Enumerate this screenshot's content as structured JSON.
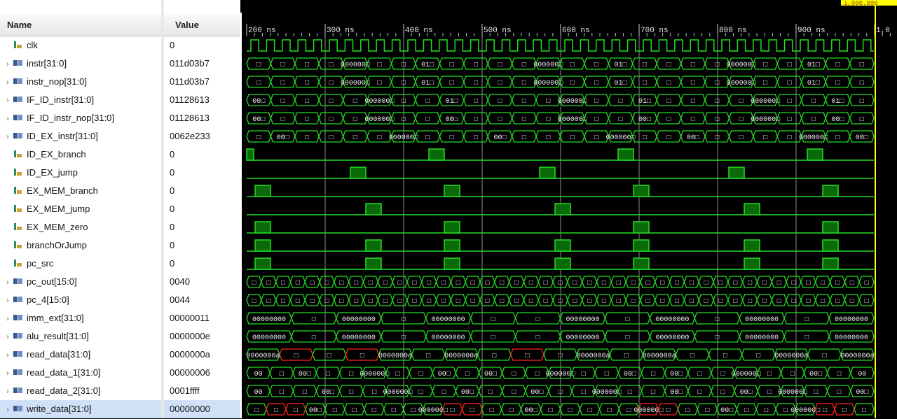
{
  "columns": {
    "name": "Name",
    "value": "Value"
  },
  "cursor": {
    "label": "1,000.000"
  },
  "timeline": {
    "ticks": [
      "200 ns",
      "300 ns",
      "400 ns",
      "500 ns",
      "600 ns",
      "700 ns",
      "800 ns",
      "900 ns",
      "1,0"
    ]
  },
  "signals": [
    {
      "name": "clk",
      "value": "0",
      "kind": "bit",
      "expandable": false
    },
    {
      "name": "instr[31:0]",
      "value": "011d03b7",
      "kind": "bus",
      "expandable": true
    },
    {
      "name": "instr_nop[31:0]",
      "value": "011d03b7",
      "kind": "bus",
      "expandable": true
    },
    {
      "name": "IF_ID_instr[31:0]",
      "value": "01128613",
      "kind": "bus",
      "expandable": true
    },
    {
      "name": "IF_ID_instr_nop[31:0]",
      "value": "01128613",
      "kind": "bus",
      "expandable": true
    },
    {
      "name": "ID_EX_instr[31:0]",
      "value": "0062e233",
      "kind": "bus",
      "expandable": true
    },
    {
      "name": "ID_EX_branch",
      "value": "0",
      "kind": "bit",
      "expandable": false
    },
    {
      "name": "ID_EX_jump",
      "value": "0",
      "kind": "bit",
      "expandable": false
    },
    {
      "name": "EX_MEM_branch",
      "value": "0",
      "kind": "bit",
      "expandable": false
    },
    {
      "name": "EX_MEM_jump",
      "value": "0",
      "kind": "bit",
      "expandable": false
    },
    {
      "name": "EX_MEM_zero",
      "value": "0",
      "kind": "bit",
      "expandable": false
    },
    {
      "name": "branchOrJump",
      "value": "0",
      "kind": "bit",
      "expandable": false
    },
    {
      "name": "pc_src",
      "value": "0",
      "kind": "bit",
      "expandable": false
    },
    {
      "name": "pc_out[15:0]",
      "value": "0040",
      "kind": "bus",
      "expandable": true
    },
    {
      "name": "pc_4[15:0]",
      "value": "0044",
      "kind": "bus",
      "expandable": true
    },
    {
      "name": "imm_ext[31:0]",
      "value": "00000011",
      "kind": "bus",
      "expandable": true
    },
    {
      "name": "alu_result[31:0]",
      "value": "0000000e",
      "kind": "bus",
      "expandable": true
    },
    {
      "name": "read_data[31:0]",
      "value": "0000000a",
      "kind": "bus",
      "expandable": true
    },
    {
      "name": "read_data_1[31:0]",
      "value": "00000006",
      "kind": "bus",
      "expandable": true
    },
    {
      "name": "read_data_2[31:0]",
      "value": "0001ffff",
      "kind": "bus",
      "expandable": true
    },
    {
      "name": "write_data[31:0]",
      "value": "00000000",
      "kind": "bus",
      "expandable": true,
      "selected": true
    }
  ],
  "waves": {
    "instr": [
      "□",
      "□",
      "□",
      "□",
      "000000□",
      "□",
      "□",
      "01□",
      "□",
      "□",
      "□",
      "□",
      "000000□",
      "□",
      "□",
      "01□",
      "□",
      "□",
      "□",
      "□",
      "000000□",
      "□",
      "□",
      "01□",
      "□",
      "□"
    ],
    "instr_nop": [
      "□",
      "□",
      "□",
      "□",
      "000000□",
      "□",
      "□",
      "01□",
      "□",
      "□",
      "□",
      "□",
      "000000□",
      "□",
      "□",
      "01□",
      "□",
      "□",
      "□",
      "□",
      "000000□",
      "□",
      "□",
      "01□",
      "□",
      "□"
    ],
    "IF_ID_instr": [
      "00□",
      "□",
      "□",
      "□",
      "□",
      "000000□",
      "□",
      "□",
      "01□",
      "□",
      "□",
      "□",
      "□",
      "000000□",
      "□",
      "□",
      "01□",
      "□",
      "□",
      "□",
      "□",
      "000000□",
      "□",
      "□",
      "01□",
      "□"
    ],
    "IF_ID_instr_nop": [
      "00□",
      "□",
      "□",
      "□",
      "□",
      "000000□",
      "□",
      "□",
      "00□",
      "□",
      "□",
      "□",
      "□",
      "000000□",
      "□",
      "□",
      "00□",
      "□",
      "□",
      "□",
      "□",
      "000000□",
      "□",
      "□",
      "00□",
      "□"
    ],
    "ID_EX_instr": [
      "□",
      "00□",
      "□",
      "□",
      "□",
      "□",
      "000000□",
      "□",
      "□",
      "□",
      "00□",
      "□",
      "□",
      "□",
      "□",
      "000000□",
      "□",
      "□",
      "00□",
      "□",
      "□",
      "□",
      "□",
      "000000□",
      "□",
      "00□"
    ],
    "pc_out": [
      "□",
      "□",
      "□",
      "□",
      "□",
      "□",
      "□",
      "□",
      "□",
      "□",
      "□",
      "□",
      "□",
      "□",
      "□",
      "□",
      "□",
      "□",
      "□",
      "□",
      "□",
      "□",
      "□",
      "□",
      "□",
      "□",
      "□",
      "□",
      "□",
      "□",
      "□",
      "□",
      "□",
      "□",
      "□",
      "□",
      "□",
      "□",
      "□",
      "□",
      "□",
      "□",
      "□"
    ],
    "imm_ext": [
      "00000000",
      "□",
      "00000000",
      "□",
      "00000000",
      "□",
      "□",
      "00000000",
      "□",
      "00000000",
      "□",
      "00000000",
      "□",
      "00000000"
    ],
    "alu_result": [
      "00000000",
      "□",
      "00000000",
      "□",
      "00000000",
      "□",
      "□",
      "00000000",
      "□",
      "00000000",
      "□",
      "00000000",
      "□",
      "00000000"
    ],
    "read_data": [
      "0000000a",
      "□",
      "□",
      "□",
      "0000000a",
      "□",
      "0000000a",
      "□",
      "□",
      "□",
      "0000000a",
      "□",
      "0000000a",
      "□",
      "□",
      "□",
      "0000000a",
      "□",
      "0000000a"
    ],
    "read_data_1": [
      "00",
      "□",
      "00□",
      "□",
      "□",
      "000000□",
      "□",
      "□",
      "00□",
      "□",
      "00□",
      "□",
      "□",
      "000000□",
      "□",
      "□",
      "00□",
      "□",
      "00□",
      "□",
      "□",
      "000000□",
      "□",
      "□",
      "00□",
      "□",
      "00"
    ],
    "read_data_2": [
      "00",
      "□",
      "□",
      "00□",
      "□",
      "□",
      "000000□",
      "□",
      "□",
      "00□",
      "□",
      "□",
      "00□",
      "□",
      "□",
      "000000□",
      "□",
      "□",
      "00□",
      "□",
      "□",
      "00□",
      "□",
      "000000□",
      "□",
      "□",
      "00□"
    ],
    "write_data": [
      "□",
      "□",
      "□",
      "00□",
      "□",
      "□",
      "□",
      "□",
      "□",
      "000000□",
      "□",
      "□",
      "□",
      "□",
      "00□",
      "□",
      "□",
      "□",
      "□",
      "□",
      "000000□",
      "□",
      "□",
      "□",
      "00□",
      "□",
      "□",
      "□",
      "000000□",
      "□",
      "□",
      "□"
    ]
  },
  "colors": {
    "wave": "#22dd22",
    "pulse_fill": "#0a6a0a",
    "grid": "#8a8a8a",
    "cursor": "#ffff00",
    "bus_x": "#ff2222",
    "icon_bit": "#2e8b57",
    "icon_bus": "#3a5a8c"
  }
}
